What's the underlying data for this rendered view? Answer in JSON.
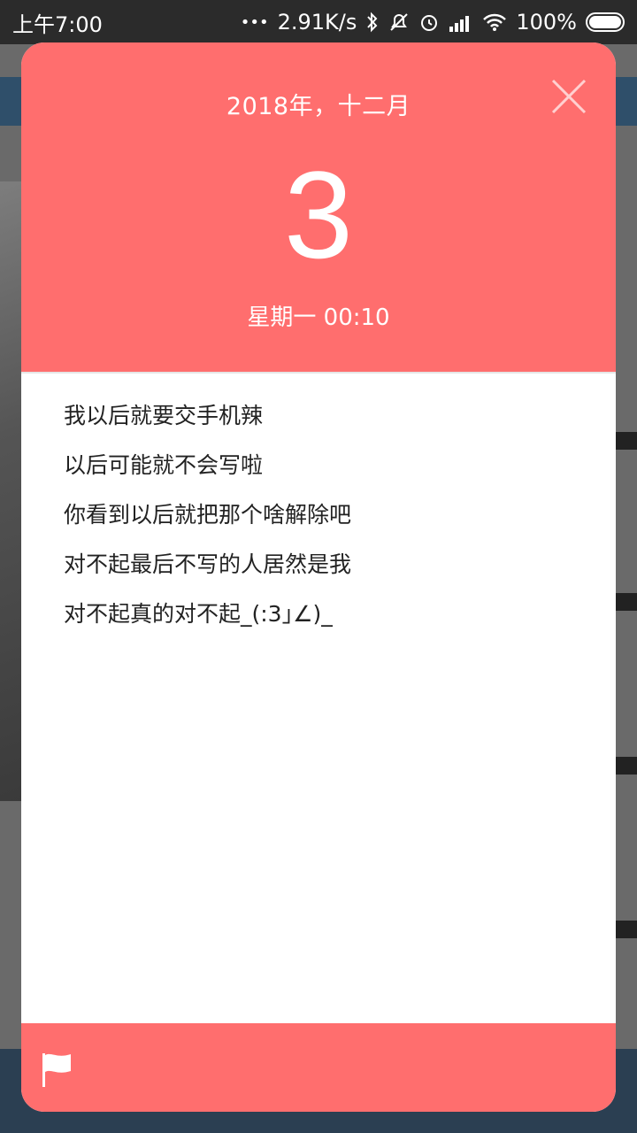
{
  "status_bar": {
    "time": "上午7:00",
    "dots": "•••",
    "speed": "2.91K/s",
    "battery": "100%",
    "icons": [
      "bluetooth-icon",
      "mute-icon",
      "alarm-icon",
      "signal-icon",
      "wifi-icon",
      "battery-icon"
    ]
  },
  "dialog": {
    "header": {
      "month_label": "2018年，十二月",
      "day": "3",
      "weekday_time": "星期一 00:10"
    },
    "body_lines": [
      "我以后就要交手机辣",
      "以后可能就不会写啦",
      "你看到以后就把那个啥解除吧",
      "对不起最后不写的人居然是我",
      "对不起真的对不起_(:3｣∠)_"
    ],
    "footer": {
      "icon": "flag-icon"
    }
  },
  "colors": {
    "accent": "#ff6e6e",
    "status_bar": "#2b2b2b",
    "body_text": "#222222"
  }
}
